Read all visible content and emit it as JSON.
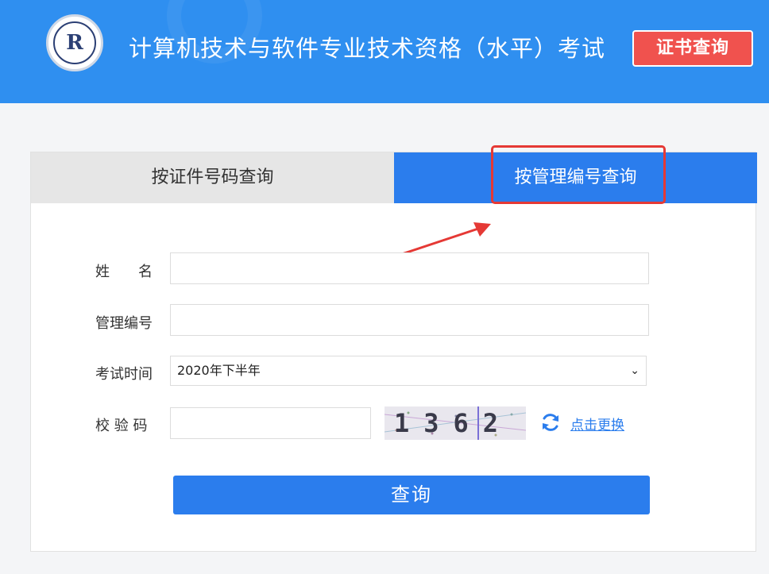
{
  "header": {
    "title": "计算机技术与软件专业技术资格（水平）考试",
    "cert_query_button": "证书查询",
    "logo_icon": "exam-logo-icon"
  },
  "tabs": [
    {
      "label": "按证件号码查询",
      "active": false
    },
    {
      "label": "按管理编号查询",
      "active": true
    }
  ],
  "form": {
    "name_label": "姓　　名",
    "name_value": "",
    "mgmt_label": "管理编号",
    "mgmt_value": "",
    "time_label": "考试时间",
    "time_selected": "2020年下半年",
    "captcha_label": "校 验 码",
    "captcha_value": "",
    "captcha_text": "1362",
    "refresh_label": "点击更换",
    "submit_label": "查询"
  },
  "colors": {
    "header_bg": "#2f8ff0",
    "accent_blue": "#2b7ded",
    "cert_button_red": "#f0524e",
    "annotation_red": "#e53935"
  }
}
